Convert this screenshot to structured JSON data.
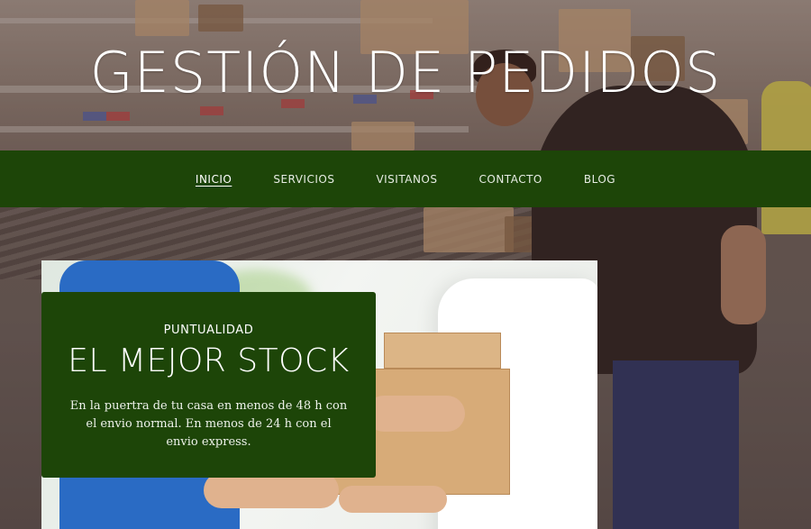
{
  "header": {
    "title": "GESTIÓN DE PEDIDOS"
  },
  "nav": {
    "items": [
      {
        "label": "INICIO",
        "active": true
      },
      {
        "label": "SERVICIOS",
        "active": false
      },
      {
        "label": "VISITANOS",
        "active": false
      },
      {
        "label": "CONTACTO",
        "active": false
      },
      {
        "label": "BLOG",
        "active": false
      }
    ]
  },
  "feature": {
    "eyebrow": "PUNTUALIDAD",
    "title": "EL MEJOR STOCK",
    "text": "En la puertra de tu casa en menos de 48 h con el envio normal. En menos de 24 h con el envio express."
  },
  "colors": {
    "brand_green": "#1d4508",
    "text_light": "#ffffff"
  }
}
